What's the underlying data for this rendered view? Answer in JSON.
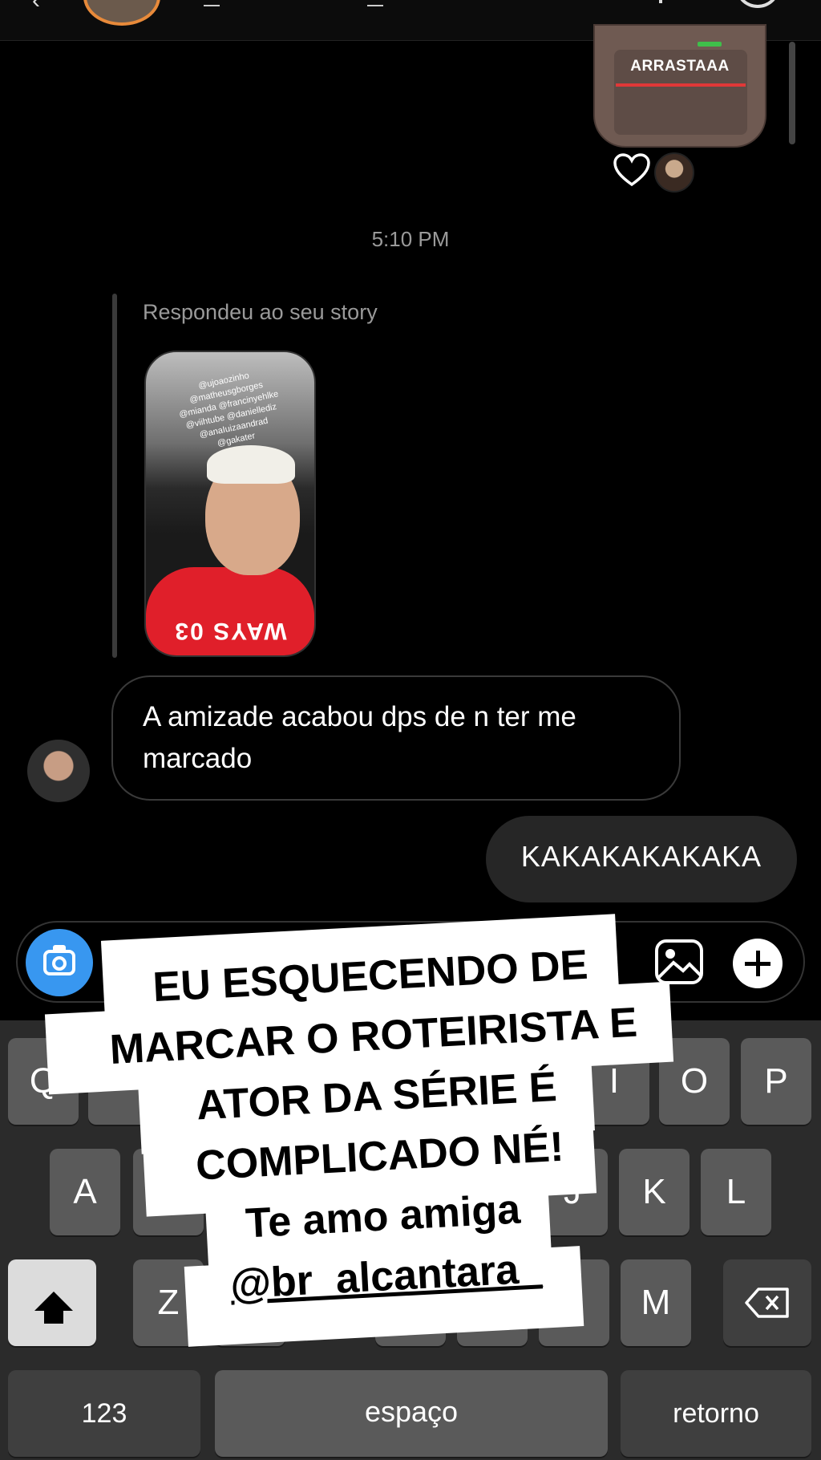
{
  "header": {
    "back_icon": "‹",
    "avatar": "profile-avatar"
  },
  "sent_story": {
    "label": "ARRASTAAA"
  },
  "reaction": {
    "icon": "heart-icon"
  },
  "timestamp": "5:10 PM",
  "reply": {
    "label": "Respondeu ao seu story",
    "thumb_tags": [
      "@ujoaozinho",
      "@matheusgborges",
      "@mianda @francinyehlke",
      "@viihtube @daniellediz",
      "@anaIuizaandrad",
      "@gakater"
    ],
    "shirt_text": "WAYS 03"
  },
  "messages": {
    "received": "A amizade acabou dps de n ter me marcado",
    "sent": "KAKAKAKAKAKA"
  },
  "composer": {
    "camera_icon": "camera-icon",
    "gallery_icon": "image-icon",
    "plus_icon": "plus-icon"
  },
  "keyboard": {
    "row1_visible": [
      "Q",
      "I",
      "O",
      "P"
    ],
    "row2_visible": [
      "A",
      "J",
      "K",
      "L"
    ],
    "row3_visible": [
      "Z",
      "M"
    ],
    "numbers_label": "123",
    "space_label": "espaço",
    "return_label": "retorno",
    "shift_icon": "shift-icon",
    "backspace_icon": "backspace-icon"
  },
  "overlay": {
    "line1": "EU ESQUECENDO DE",
    "line2": "MARCAR O ROTEIRISTA E",
    "line3": "ATOR DA SÉRIE É",
    "line4": "COMPLICADO NÉ!",
    "line5": "Te amo amiga",
    "line6": "@br_alcantara_"
  },
  "colors": {
    "accent_blue": "#3897f0",
    "story_ring": "#e88a3a",
    "background": "#000000",
    "bubble_sent": "#262626"
  }
}
